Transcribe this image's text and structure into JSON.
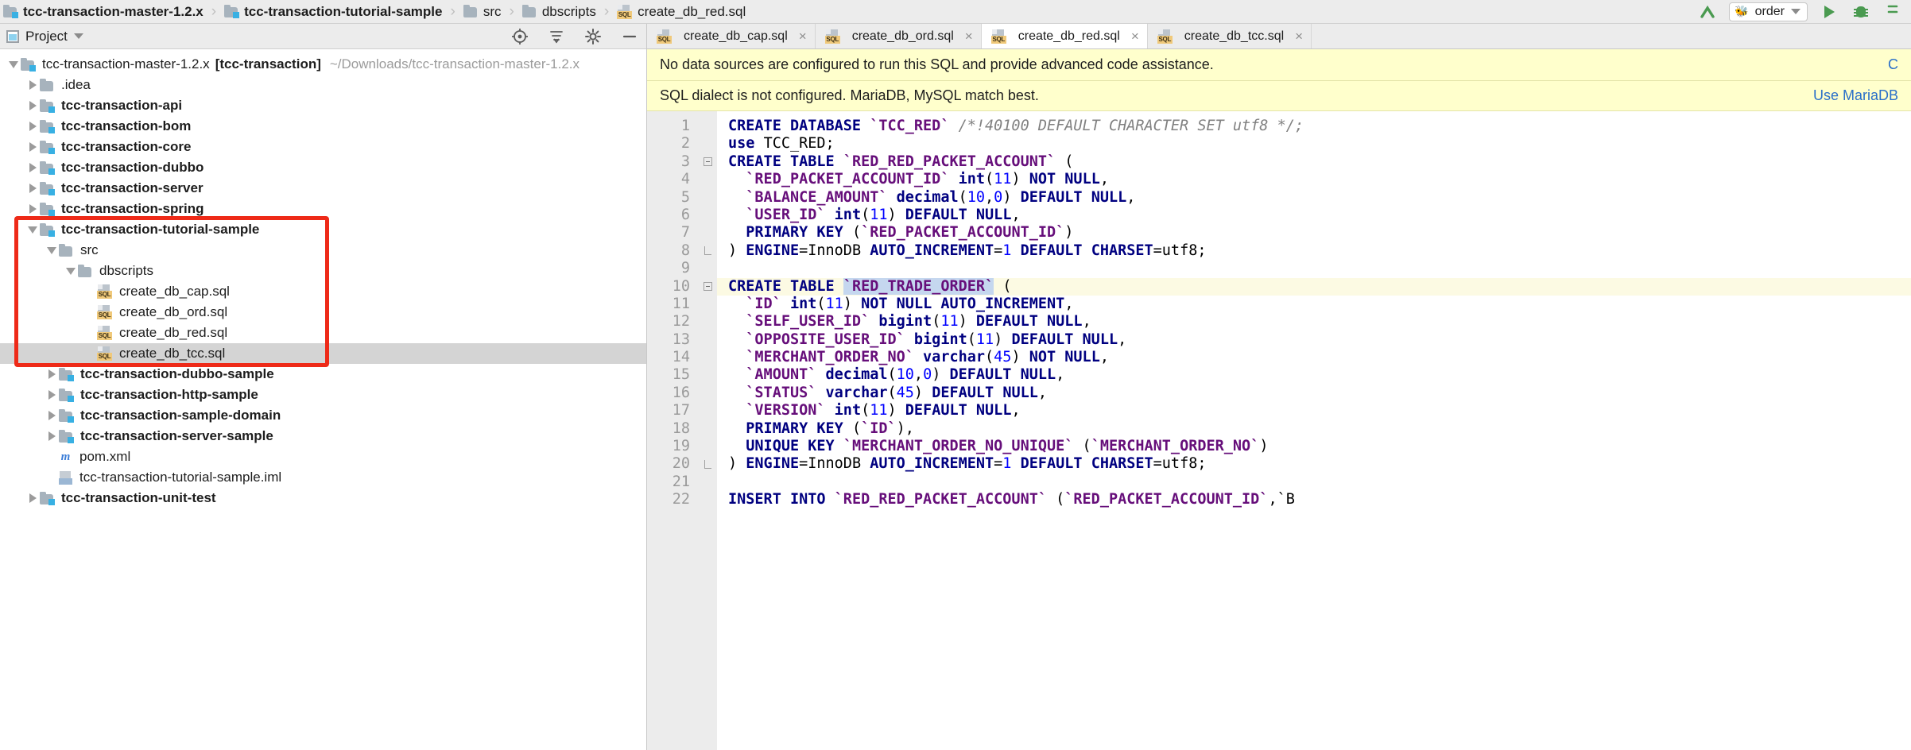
{
  "breadcrumb": {
    "items": [
      {
        "label": "tcc-transaction-master-1.2.x",
        "icon": "module-folder-icon",
        "bold": true
      },
      {
        "label": "tcc-transaction-tutorial-sample",
        "icon": "module-folder-icon",
        "bold": true
      },
      {
        "label": "src",
        "icon": "folder-icon",
        "bold": false
      },
      {
        "label": "dbscripts",
        "icon": "folder-icon",
        "bold": false
      },
      {
        "label": "create_db_red.sql",
        "icon": "sql-file-icon",
        "bold": false
      }
    ],
    "separator": "›"
  },
  "toolbar": {
    "run_config_label": "order",
    "run_config_icon": "bee-icon",
    "build_icon": "make-project-icon",
    "run_icon": "run-icon",
    "debug_icon": "debug-icon",
    "more_icon": "more-icon"
  },
  "project_panel": {
    "title": "Project",
    "title_icon": "project-view-icon",
    "dropdown_icon": "chevron-down-icon",
    "tools": [
      {
        "name": "locate-icon",
        "glyph": "⊕"
      },
      {
        "name": "collapse-all-icon",
        "glyph": "⤓"
      },
      {
        "name": "settings-gear-icon",
        "glyph": "⚙"
      },
      {
        "name": "hide-panel-icon",
        "glyph": "—"
      }
    ]
  },
  "tree": {
    "nodes": [
      {
        "id": "root",
        "label": "tcc-transaction-master-1.2.x",
        "module": "[tcc-transaction]",
        "path": "~/Downloads/tcc-transaction-master-1.2.x",
        "indent": 0,
        "arrow": "down",
        "icon": "module-folder-icon",
        "bold": false,
        "selected": false
      },
      {
        "id": "idea",
        "label": ".idea",
        "indent": 1,
        "arrow": "right",
        "icon": "folder-icon",
        "bold": false,
        "selected": false
      },
      {
        "id": "api",
        "label": "tcc-transaction-api",
        "indent": 1,
        "arrow": "right",
        "icon": "module-folder-icon",
        "bold": true,
        "selected": false
      },
      {
        "id": "bom",
        "label": "tcc-transaction-bom",
        "indent": 1,
        "arrow": "right",
        "icon": "module-folder-icon",
        "bold": true,
        "selected": false
      },
      {
        "id": "core",
        "label": "tcc-transaction-core",
        "indent": 1,
        "arrow": "right",
        "icon": "module-folder-icon",
        "bold": true,
        "selected": false
      },
      {
        "id": "dubbo",
        "label": "tcc-transaction-dubbo",
        "indent": 1,
        "arrow": "right",
        "icon": "module-folder-icon",
        "bold": true,
        "selected": false
      },
      {
        "id": "server",
        "label": "tcc-transaction-server",
        "indent": 1,
        "arrow": "right",
        "icon": "module-folder-icon",
        "bold": true,
        "selected": false
      },
      {
        "id": "spring",
        "label": "tcc-transaction-spring",
        "indent": 1,
        "arrow": "right",
        "icon": "module-folder-icon",
        "bold": true,
        "selected": false
      },
      {
        "id": "tutorial",
        "label": "tcc-transaction-tutorial-sample",
        "indent": 1,
        "arrow": "down",
        "icon": "module-folder-icon",
        "bold": true,
        "selected": false
      },
      {
        "id": "src",
        "label": "src",
        "indent": 2,
        "arrow": "down",
        "icon": "folder-icon",
        "bold": false,
        "selected": false
      },
      {
        "id": "dbscripts",
        "label": "dbscripts",
        "indent": 3,
        "arrow": "down",
        "icon": "folder-icon",
        "bold": false,
        "selected": false
      },
      {
        "id": "cap",
        "label": "create_db_cap.sql",
        "indent": 4,
        "arrow": "none",
        "icon": "sql-file-icon",
        "bold": false,
        "selected": false
      },
      {
        "id": "ord",
        "label": "create_db_ord.sql",
        "indent": 4,
        "arrow": "none",
        "icon": "sql-file-icon",
        "bold": false,
        "selected": false
      },
      {
        "id": "red",
        "label": "create_db_red.sql",
        "indent": 4,
        "arrow": "none",
        "icon": "sql-file-icon",
        "bold": false,
        "selected": false
      },
      {
        "id": "tcc",
        "label": "create_db_tcc.sql",
        "indent": 4,
        "arrow": "none",
        "icon": "sql-file-icon",
        "bold": false,
        "selected": true
      },
      {
        "id": "dubbosample",
        "label": "tcc-transaction-dubbo-sample",
        "indent": 2,
        "arrow": "right",
        "icon": "module-folder-icon",
        "bold": true,
        "selected": false
      },
      {
        "id": "httpsample",
        "label": "tcc-transaction-http-sample",
        "indent": 2,
        "arrow": "right",
        "icon": "module-folder-icon",
        "bold": true,
        "selected": false
      },
      {
        "id": "sampledomain",
        "label": "tcc-transaction-sample-domain",
        "indent": 2,
        "arrow": "right",
        "icon": "module-folder-icon",
        "bold": true,
        "selected": false
      },
      {
        "id": "serversample",
        "label": "tcc-transaction-server-sample",
        "indent": 2,
        "arrow": "right",
        "icon": "module-folder-icon",
        "bold": true,
        "selected": false
      },
      {
        "id": "pom",
        "label": "pom.xml",
        "indent": 2,
        "arrow": "none",
        "icon": "maven-xml-icon",
        "bold": false,
        "selected": false
      },
      {
        "id": "iml",
        "label": "tcc-transaction-tutorial-sample.iml",
        "indent": 2,
        "arrow": "none",
        "icon": "iml-file-icon",
        "bold": false,
        "selected": false
      },
      {
        "id": "unittest",
        "label": "tcc-transaction-unit-test",
        "indent": 1,
        "arrow": "right",
        "icon": "module-folder-icon",
        "bold": true,
        "selected": false
      }
    ]
  },
  "tabs": [
    {
      "label": "create_db_cap.sql",
      "icon": "sql-file-icon",
      "active": false,
      "close": "×"
    },
    {
      "label": "create_db_ord.sql",
      "icon": "sql-file-icon",
      "active": false,
      "close": "×"
    },
    {
      "label": "create_db_red.sql",
      "icon": "sql-file-icon",
      "active": true,
      "close": "×"
    },
    {
      "label": "create_db_tcc.sql",
      "icon": "sql-file-icon",
      "active": false,
      "close": "×"
    }
  ],
  "notifications": [
    {
      "text": "No data sources are configured to run this SQL and provide advanced code assistance.",
      "action": "C",
      "id": "datasource-notice"
    },
    {
      "text": "SQL dialect is not configured. MariaDB, MySQL match best.",
      "action": "Use MariaDB",
      "id": "dialect-notice"
    }
  ],
  "editor": {
    "highlighted_line": 10,
    "selection_text": "RED_TRADE_ORDER",
    "lines": [
      {
        "n": 1,
        "fold": "none"
      },
      {
        "n": 2,
        "fold": "none"
      },
      {
        "n": 3,
        "fold": "start"
      },
      {
        "n": 4,
        "fold": "none"
      },
      {
        "n": 5,
        "fold": "none"
      },
      {
        "n": 6,
        "fold": "none"
      },
      {
        "n": 7,
        "fold": "none"
      },
      {
        "n": 8,
        "fold": "end"
      },
      {
        "n": 9,
        "fold": "none"
      },
      {
        "n": 10,
        "fold": "start"
      },
      {
        "n": 11,
        "fold": "none"
      },
      {
        "n": 12,
        "fold": "none"
      },
      {
        "n": 13,
        "fold": "none"
      },
      {
        "n": 14,
        "fold": "none"
      },
      {
        "n": 15,
        "fold": "none"
      },
      {
        "n": 16,
        "fold": "none"
      },
      {
        "n": 17,
        "fold": "none"
      },
      {
        "n": 18,
        "fold": "none"
      },
      {
        "n": 19,
        "fold": "none"
      },
      {
        "n": 20,
        "fold": "end"
      },
      {
        "n": 21,
        "fold": "none"
      },
      {
        "n": 22,
        "fold": "none"
      }
    ],
    "code_text": [
      "CREATE DATABASE `TCC_RED` /*!40100 DEFAULT CHARACTER SET utf8 */;",
      "use TCC_RED;",
      "CREATE TABLE `RED_RED_PACKET_ACCOUNT` (",
      "  `RED_PACKET_ACCOUNT_ID` int(11) NOT NULL,",
      "  `BALANCE_AMOUNT` decimal(10,0) DEFAULT NULL,",
      "  `USER_ID` int(11) DEFAULT NULL,",
      "  PRIMARY KEY (`RED_PACKET_ACCOUNT_ID`)",
      ") ENGINE=InnoDB AUTO_INCREMENT=1 DEFAULT CHARSET=utf8;",
      "",
      "CREATE TABLE `RED_TRADE_ORDER` (",
      "  `ID` int(11) NOT NULL AUTO_INCREMENT,",
      "  `SELF_USER_ID` bigint(11) DEFAULT NULL,",
      "  `OPPOSITE_USER_ID` bigint(11) DEFAULT NULL,",
      "  `MERCHANT_ORDER_NO` varchar(45) NOT NULL,",
      "  `AMOUNT` decimal(10,0) DEFAULT NULL,",
      "  `STATUS` varchar(45) DEFAULT NULL,",
      "  `VERSION` int(11) DEFAULT NULL,",
      "  PRIMARY KEY (`ID`),",
      "  UNIQUE KEY `MERCHANT_ORDER_NO_UNIQUE` (`MERCHANT_ORDER_NO`)",
      ") ENGINE=InnoDB AUTO_INCREMENT=1 DEFAULT CHARSET=utf8;",
      "",
      "INSERT INTO `RED_RED_PACKET_ACCOUNT` (`RED_PACKET_ACCOUNT_ID`,`B"
    ]
  },
  "colors": {
    "keyword": "#000080",
    "identifier": "#660e7a",
    "number": "#0000ff",
    "comment": "#808080",
    "notice_bg": "#ffffcc",
    "link": "#2a6fc9",
    "highlight_box": "#ee2a18",
    "selection": "#c5d7ef"
  }
}
